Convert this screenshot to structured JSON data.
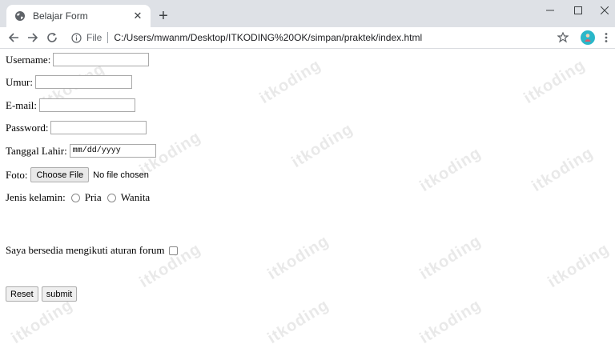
{
  "browser": {
    "tab_title": "Belajar Form",
    "tab_close": "✕",
    "new_tab": "+",
    "address_scheme": "File",
    "url": "C:/Users/mwanm/Desktop/ITKODING%20OK/simpan/praktek/index.html",
    "icons": [
      "globe-icon",
      "back-icon",
      "forward-icon",
      "reload-icon",
      "info-icon",
      "star-icon",
      "avatar",
      "menu-icon",
      "minimize-icon",
      "maximize-icon",
      "close-icon"
    ]
  },
  "watermark": "itkoding",
  "form": {
    "username_label": "Username:",
    "umur_label": "Umur:",
    "email_label": "E-mail:",
    "password_label": "Password:",
    "tanggal_label": "Tanggal Lahir:",
    "date_placeholder": "mm/dd/yyyy",
    "foto_label": "Foto:",
    "choose_file": "Choose File",
    "no_file": "No file chosen",
    "gender_label": "Jenis kelamin:",
    "gender_options": [
      "Pria",
      "Wanita"
    ],
    "agree_label": "Saya bersedia mengikuti aturan forum",
    "reset_button": "Reset",
    "submit_button": "submit"
  },
  "colors": {
    "tabstrip": "#dee1e6",
    "avatar": "#2ab7c9",
    "watermark": "#e9e9e9"
  }
}
